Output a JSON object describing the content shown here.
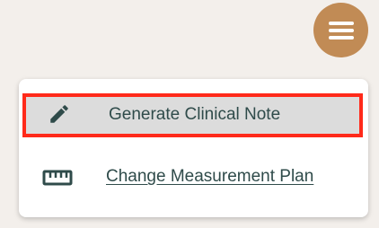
{
  "header": {
    "menu_icon": "hamburger-menu-icon",
    "menu_button_color": "#c18b55"
  },
  "dropdown": {
    "items": [
      {
        "label": "Generate Clinical Note",
        "icon": "pencil-icon",
        "highlighted": true
      },
      {
        "label": "Change Measurement Plan",
        "icon": "ruler-icon",
        "highlighted": false
      }
    ]
  },
  "colors": {
    "background": "#f3efeb",
    "text": "#2f4b4a",
    "highlight_border": "#ff2a1a",
    "highlight_fill": "#dcdcdc"
  }
}
